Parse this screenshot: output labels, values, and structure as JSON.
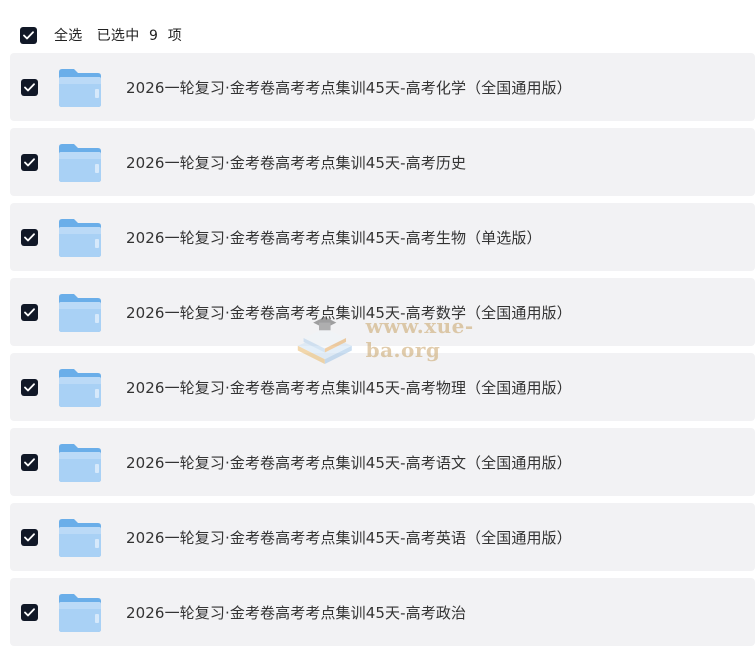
{
  "header": {
    "select_all_label": "全选",
    "selected_text": "已选中  9  项"
  },
  "items": [
    {
      "label": "2026一轮复习·金考卷高考考点集训45天-高考化学（全国通用版）"
    },
    {
      "label": "2026一轮复习·金考卷高考考点集训45天-高考历史"
    },
    {
      "label": "2026一轮复习·金考卷高考考点集训45天-高考生物（单选版）"
    },
    {
      "label": "2026一轮复习·金考卷高考考点集训45天-高考数学（全国通用版）"
    },
    {
      "label": "2026一轮复习·金考卷高考考点集训45天-高考物理（全国通用版）"
    },
    {
      "label": "2026一轮复习·金考卷高考考点集训45天-高考语文（全国通用版）"
    },
    {
      "label": "2026一轮复习·金考卷高考考点集训45天-高考英语（全国通用版）"
    },
    {
      "label": "2026一轮复习·金考卷高考考点集训45天-高考政治"
    }
  ],
  "watermark": {
    "text": "www.xue-ba.org"
  },
  "colors": {
    "checkbox": "#111827",
    "row_bg": "#f2f2f4",
    "folder": "#7db9ee"
  },
  "icons": {
    "checkbox": "checkmark-icon",
    "item": "folder-icon",
    "watermark": "books-logo-icon"
  }
}
